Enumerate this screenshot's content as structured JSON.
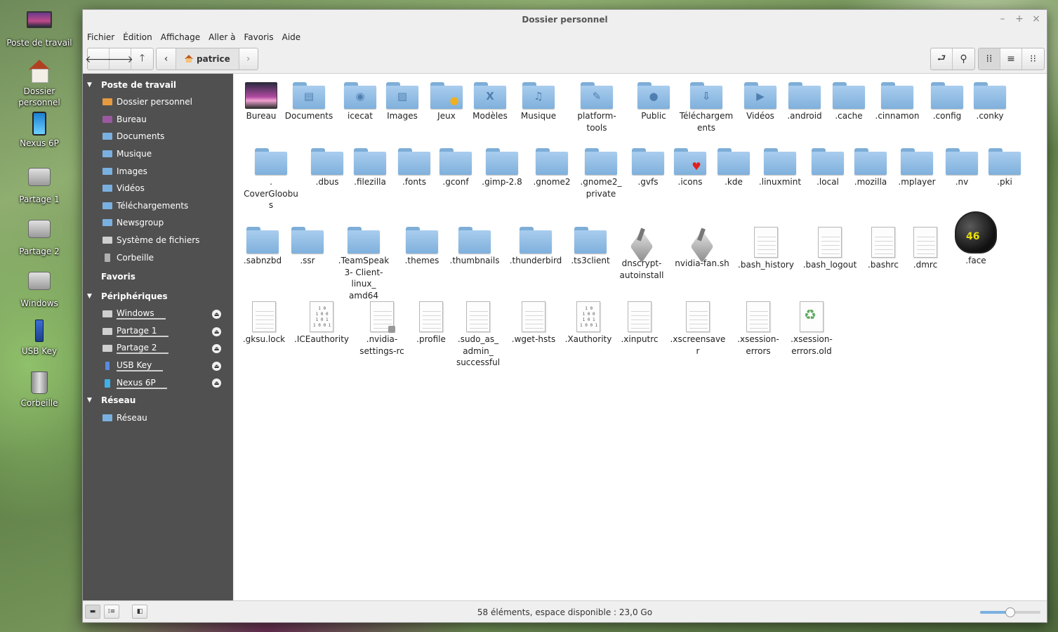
{
  "desktop": {
    "icons": [
      {
        "label": "Poste de travail",
        "icon": "computer-icon"
      },
      {
        "label": "Dossier\npersonnel",
        "icon": "home-icon"
      },
      {
        "label": "Nexus 6P",
        "icon": "phone-icon"
      },
      {
        "label": "Partage 1",
        "icon": "drive-icon"
      },
      {
        "label": "Partage 2",
        "icon": "drive-icon"
      },
      {
        "label": "Windows",
        "icon": "drive-icon"
      },
      {
        "label": "USB Key",
        "icon": "usb-icon"
      },
      {
        "label": "Corbeille",
        "icon": "trash-icon"
      }
    ]
  },
  "window": {
    "title": "Dossier personnel",
    "controls": {
      "minimize": "–",
      "maximize": "+",
      "close": "×"
    }
  },
  "menu": [
    "Fichier",
    "Édition",
    "Affichage",
    "Aller à",
    "Favoris",
    "Aide"
  ],
  "toolbar": {
    "back": "🡐",
    "forward": "🡒",
    "up": "🡑",
    "crumb_prev": "‹",
    "crumb_next": "›",
    "location": "patrice",
    "toggle_location": "⮐",
    "search": "⚲",
    "view_icons": "⁞⁞",
    "view_list": "≡",
    "view_compact": "⁝⁝"
  },
  "sidebar": {
    "sections": [
      {
        "title": "Poste de travail",
        "collapsible": true,
        "items": [
          {
            "label": "Dossier personnel",
            "icon": "home"
          },
          {
            "label": "Bureau",
            "icon": "desk"
          },
          {
            "label": "Documents",
            "icon": "folder"
          },
          {
            "label": "Musique",
            "icon": "folder"
          },
          {
            "label": "Images",
            "icon": "folder"
          },
          {
            "label": "Vidéos",
            "icon": "folder"
          },
          {
            "label": "Téléchargements",
            "icon": "folder"
          },
          {
            "label": "Newsgroup",
            "icon": "folder"
          },
          {
            "label": "Système de fichiers",
            "icon": "drive"
          },
          {
            "label": "Corbeille",
            "icon": "trash"
          }
        ]
      },
      {
        "title": "Favoris",
        "collapsible": false,
        "items": []
      },
      {
        "title": "Périphériques",
        "collapsible": true,
        "items": [
          {
            "label": "Windows",
            "icon": "drive",
            "eject": true
          },
          {
            "label": "Partage 1",
            "icon": "drive",
            "eject": true
          },
          {
            "label": "Partage 2",
            "icon": "drive",
            "eject": true
          },
          {
            "label": "USB Key",
            "icon": "usb",
            "eject": true
          },
          {
            "label": "Nexus 6P",
            "icon": "phone",
            "eject": true
          }
        ]
      },
      {
        "title": "Réseau",
        "collapsible": true,
        "items": [
          {
            "label": "Réseau",
            "icon": "folder"
          }
        ]
      }
    ]
  },
  "files": {
    "rows": [
      [
        {
          "label": "Bureau",
          "type": "desktop"
        },
        {
          "label": "Documents",
          "type": "folder",
          "emblem": "doc"
        },
        {
          "label": "icecat",
          "type": "folder",
          "emblem": "globe"
        },
        {
          "label": "Images",
          "type": "folder",
          "emblem": "image"
        },
        {
          "label": "Jeux",
          "type": "folder",
          "emblem": "duck"
        },
        {
          "label": "Modèles",
          "type": "folder",
          "emblem": "X"
        },
        {
          "label": "Musique",
          "type": "folder",
          "emblem": "music"
        },
        {
          "label": "platform-tools",
          "type": "folder",
          "emblem": "pen"
        },
        {
          "label": "Public",
          "type": "folder",
          "emblem": "people"
        },
        {
          "label": "Téléchargem ents",
          "type": "folder",
          "emblem": "download"
        },
        {
          "label": "Vidéos",
          "type": "folder",
          "emblem": "clapper"
        },
        {
          "label": ".android",
          "type": "folder"
        },
        {
          "label": ".cache",
          "type": "folder"
        },
        {
          "label": ".cinnamon",
          "type": "folder"
        },
        {
          "label": ".config",
          "type": "folder"
        },
        {
          "label": ".conky",
          "type": "folder"
        }
      ],
      [
        {
          "label": ". CoverGloobus",
          "type": "folder"
        },
        {
          "label": ".dbus",
          "type": "folder"
        },
        {
          "label": ".filezilla",
          "type": "folder"
        },
        {
          "label": ".fonts",
          "type": "folder"
        },
        {
          "label": ".gconf",
          "type": "folder"
        },
        {
          "label": ".gimp-2.8",
          "type": "folder"
        },
        {
          "label": ".gnome2",
          "type": "folder"
        },
        {
          "label": ".gnome2_ private",
          "type": "folder"
        },
        {
          "label": ".gvfs",
          "type": "folder"
        },
        {
          "label": ".icons",
          "type": "folder",
          "emblem": "heart"
        },
        {
          "label": ".kde",
          "type": "folder"
        },
        {
          "label": ".linuxmint",
          "type": "folder"
        },
        {
          "label": ".local",
          "type": "folder"
        },
        {
          "label": ".mozilla",
          "type": "folder"
        },
        {
          "label": ".mplayer",
          "type": "folder"
        },
        {
          "label": ".nv",
          "type": "folder"
        },
        {
          "label": ".pki",
          "type": "folder"
        }
      ],
      [
        {
          "label": ".sabnzbd",
          "type": "folder"
        },
        {
          "label": ".ssr",
          "type": "folder"
        },
        {
          "label": ".TeamSpeak3- Client-linux_ amd64",
          "type": "folder"
        },
        {
          "label": ".themes",
          "type": "folder"
        },
        {
          "label": ".thumbnails",
          "type": "folder"
        },
        {
          "label": ".thunderbird",
          "type": "folder"
        },
        {
          "label": ".ts3client",
          "type": "folder"
        },
        {
          "label": "dnscrypt- autoinstall",
          "type": "script"
        },
        {
          "label": "nvidia-fan.sh",
          "type": "script"
        },
        {
          "label": ".bash_history",
          "type": "text"
        },
        {
          "label": ".bash_logout",
          "type": "text"
        },
        {
          "label": ".bashrc",
          "type": "text"
        },
        {
          "label": ".dmrc",
          "type": "text"
        },
        {
          "label": ".face",
          "type": "image"
        }
      ],
      [
        {
          "label": ".gksu.lock",
          "type": "text"
        },
        {
          "label": ".ICEauthority",
          "type": "binary"
        },
        {
          "label": ".nvidia- settings-rc",
          "type": "locked"
        },
        {
          "label": ".profile",
          "type": "text"
        },
        {
          "label": ".sudo_as_ admin_ successful",
          "type": "text"
        },
        {
          "label": ".wget-hsts",
          "type": "text"
        },
        {
          "label": ".Xauthority",
          "type": "binary"
        },
        {
          "label": ".xinputrc",
          "type": "text"
        },
        {
          "label": ".xscreensaver",
          "type": "text"
        },
        {
          "label": ".xsession- errors",
          "type": "text"
        },
        {
          "label": ".xsession- errors.old",
          "type": "recycle"
        }
      ]
    ]
  },
  "statusbar": {
    "text": "58 éléments, espace disponible : 23,0 Go",
    "zoom_level": 0.5,
    "btn_places": "▬",
    "btn_tree": "⁞≡",
    "btn_hide": "◧"
  }
}
